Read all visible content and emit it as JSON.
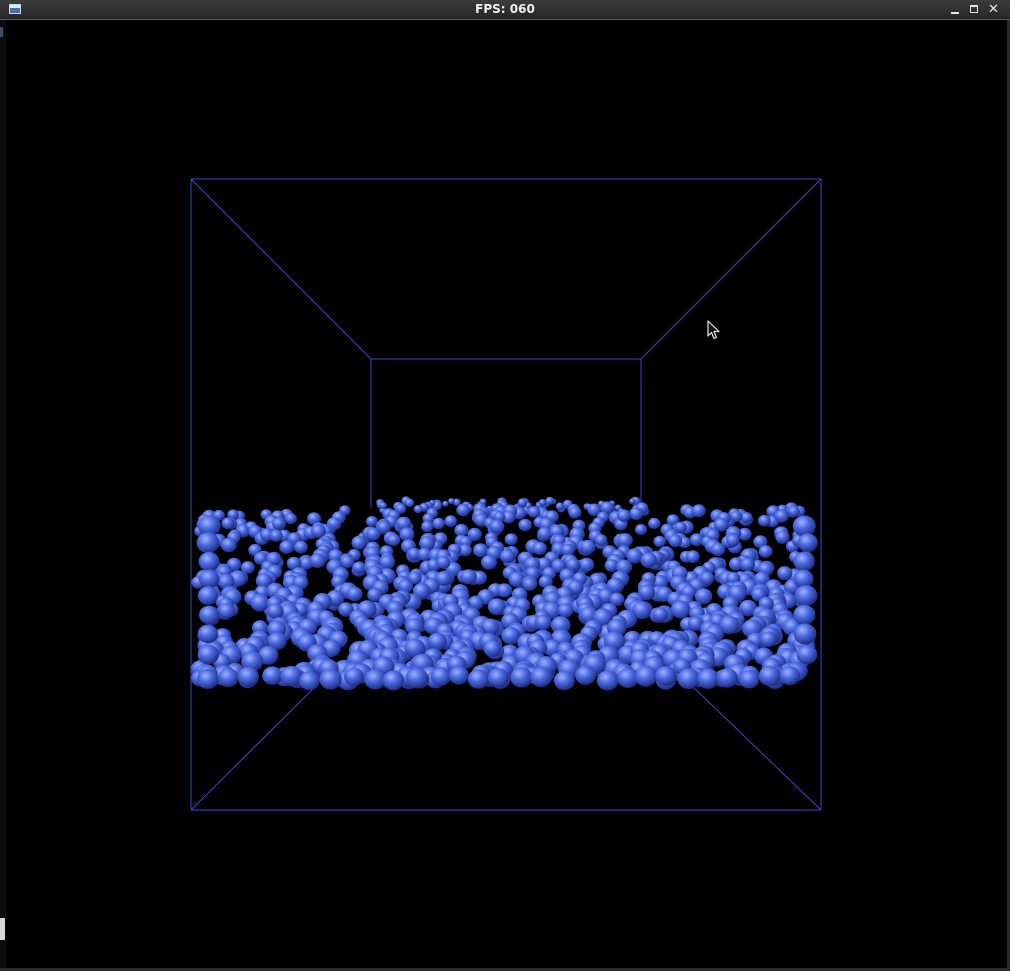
{
  "window": {
    "title": "FPS: 060",
    "icons": {
      "app": "app-window-icon",
      "minimize": "minimize-icon",
      "maximize": "maximize-icon",
      "close": "close-icon"
    },
    "close_glyph": "✕"
  },
  "scene": {
    "background_color": "#000000",
    "box_line_color": "#3a48c8",
    "particle_color": "#4a68e0",
    "particle_highlight": "#9fb2ff",
    "particle_shadow": "#1c2a7a",
    "particle_count_front": 900,
    "particle_count_back": 60,
    "cursor_icon": "mouse-pointer-icon"
  }
}
